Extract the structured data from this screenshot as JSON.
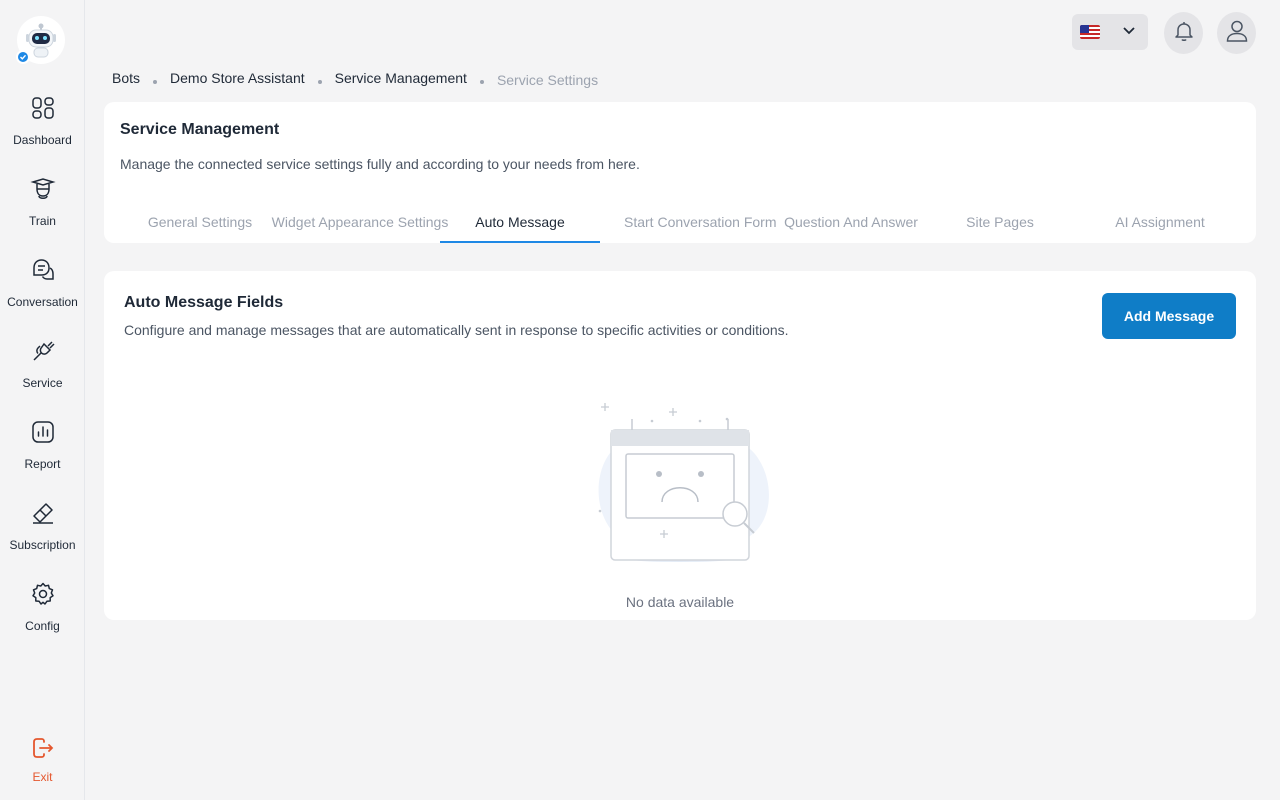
{
  "sidebar": {
    "items": [
      {
        "label": "Dashboard",
        "icon": "dashboard-icon"
      },
      {
        "label": "Train",
        "icon": "graduation-cap-icon"
      },
      {
        "label": "Conversation",
        "icon": "chat-bubbles-icon"
      },
      {
        "label": "Service",
        "icon": "plug-icon"
      },
      {
        "label": "Report",
        "icon": "bar-chart-icon"
      },
      {
        "label": "Subscription",
        "icon": "ticket-icon"
      },
      {
        "label": "Config",
        "icon": "gear-icon"
      }
    ],
    "exit": {
      "label": "Exit",
      "icon": "logout-icon"
    }
  },
  "topbar": {
    "language": "us-flag",
    "notification_icon": "bell-icon",
    "profile_icon": "user-icon"
  },
  "breadcrumb": [
    "Bots",
    "Demo Store Assistant",
    "Service Management",
    "Service Settings"
  ],
  "header": {
    "title": "Service Management",
    "description": "Manage the connected service settings fully and according to your needs from here.",
    "tabs": [
      {
        "label": "General Settings"
      },
      {
        "label": "Widget Appearance Settings"
      },
      {
        "label": "Auto Message"
      },
      {
        "label": "Start Conversation Form"
      },
      {
        "label": "Question And Answer"
      },
      {
        "label": "Site Pages"
      },
      {
        "label": "AI Assignment"
      }
    ],
    "active_tab": "Auto Message"
  },
  "content": {
    "title": "Auto Message Fields",
    "description": "Configure and manage messages that are automatically sent in response to specific activities or conditions.",
    "add_button": "Add Message",
    "empty_text": "No data available"
  },
  "colors": {
    "accent": "#1e88e5",
    "button": "#0f7dc7",
    "exit": "#e4572e"
  }
}
